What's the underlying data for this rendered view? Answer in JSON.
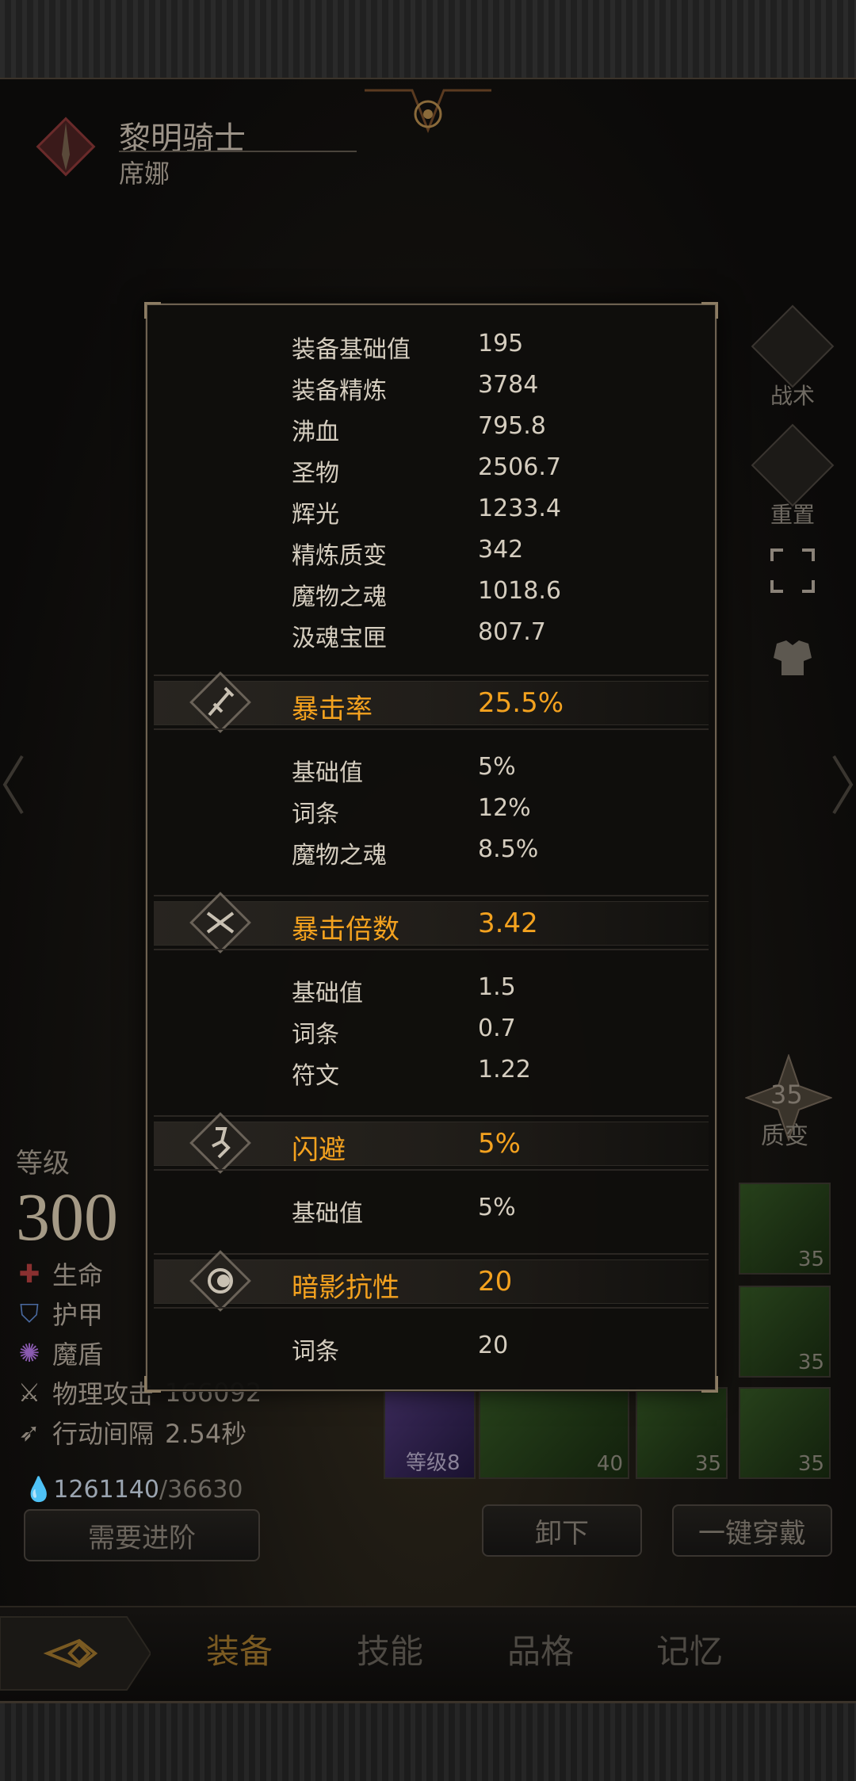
{
  "hero": {
    "title": "黎明骑士",
    "subtitle": "席娜"
  },
  "side_buttons": [
    {
      "label": "战术",
      "icon": "tactics-icon"
    },
    {
      "label": "重置",
      "icon": "helmet-icon"
    },
    {
      "label": "",
      "icon": "fullscreen-icon"
    },
    {
      "label": "",
      "icon": "armor-icon"
    }
  ],
  "quality": {
    "value": "35",
    "label": "质变"
  },
  "level": {
    "label": "等级",
    "value": "300"
  },
  "stats": [
    {
      "icon": "health-icon",
      "label": "生命",
      "value": ""
    },
    {
      "icon": "shield-icon",
      "label": "护甲",
      "value": ""
    },
    {
      "icon": "magic-shield-icon",
      "label": "魔盾",
      "value": ""
    },
    {
      "icon": "sword-icon",
      "label": "物理攻击",
      "value": "166092"
    },
    {
      "icon": "speed-icon",
      "label": "行动间隔",
      "value": "2.54秒"
    }
  ],
  "currency": {
    "current": "1261140",
    "required": "/36630"
  },
  "buttons": {
    "advance": "需要进阶",
    "unequip": "卸下",
    "equip_all": "一键穿戴"
  },
  "slots": [
    {
      "num": "35"
    },
    {
      "num": "35"
    },
    {
      "num": "等级8"
    },
    {
      "num": "40"
    },
    {
      "num": "35"
    },
    {
      "num": "35"
    }
  ],
  "tabs": [
    "装备",
    "技能",
    "品格",
    "记忆"
  ],
  "popup": {
    "top_rows": [
      {
        "k": "装备基础值",
        "v": "195"
      },
      {
        "k": "装备精炼",
        "v": "3784"
      },
      {
        "k": "沸血",
        "v": "795.8"
      },
      {
        "k": "圣物",
        "v": "2506.7"
      },
      {
        "k": "辉光",
        "v": "1233.4"
      },
      {
        "k": "精炼质变",
        "v": "342"
      },
      {
        "k": "魔物之魂",
        "v": "1018.6"
      },
      {
        "k": "汲魂宝匣",
        "v": "807.7"
      }
    ],
    "sections": [
      {
        "name": "暴击率",
        "value": "25.5%",
        "icon": "crit-rate-icon",
        "rows": [
          {
            "k": "基础值",
            "v": "5%"
          },
          {
            "k": "词条",
            "v": "12%"
          },
          {
            "k": "魔物之魂",
            "v": "8.5%"
          }
        ]
      },
      {
        "name": "暴击倍数",
        "value": "3.42",
        "icon": "crit-multiplier-icon",
        "rows": [
          {
            "k": "基础值",
            "v": "1.5"
          },
          {
            "k": "词条",
            "v": "0.7"
          },
          {
            "k": "符文",
            "v": "1.22"
          }
        ]
      },
      {
        "name": "闪避",
        "value": "5%",
        "icon": "dodge-icon",
        "rows": [
          {
            "k": "基础值",
            "v": "5%"
          }
        ]
      },
      {
        "name": "暗影抗性",
        "value": "20",
        "icon": "shadow-resist-icon",
        "rows": [
          {
            "k": "词条",
            "v": "20"
          }
        ]
      }
    ]
  }
}
